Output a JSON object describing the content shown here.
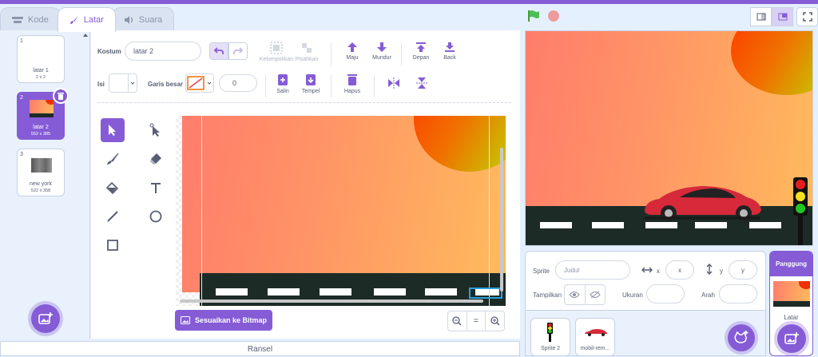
{
  "tabs": {
    "code": "Kode",
    "backdrops": "Latar",
    "sounds": "Suara"
  },
  "costumes": [
    {
      "num": "1",
      "name": "latar 1",
      "size": "2 x 2"
    },
    {
      "num": "2",
      "name": "latar 2",
      "size": "552 x 385"
    },
    {
      "num": "3",
      "name": "new york",
      "size": "522 x 358"
    }
  ],
  "editor": {
    "costume_label": "Kostum",
    "costume_name": "latar 2",
    "group": "Kelompokkan",
    "ungroup": "Pisahkan",
    "forward": "Maju",
    "backward": "Mundur",
    "front": "Depan",
    "back": "Back",
    "fill_label": "Isi",
    "outline_label": "Garis besar",
    "outline_width": "0",
    "copy": "Salin",
    "paste": "Tempel",
    "delete": "Hapus",
    "convert_bitmap": "Sesuaikan ke Bitmap",
    "zoom_reset": "="
  },
  "backpack": "Ransel",
  "sprite_info": {
    "sprite_label": "Sprite",
    "sprite_placeholder": "Judul",
    "x_label": "x",
    "x_placeholder": "x",
    "y_label": "y",
    "y_placeholder": "y",
    "show_label": "Tampilkan",
    "size_label": "Ukuran",
    "direction_label": "Arah"
  },
  "sprites": [
    {
      "name": "Sprite 2"
    },
    {
      "name": "mobil-rem..."
    }
  ],
  "stage_target": {
    "header": "Panggung",
    "label": "Latar"
  },
  "colors": {
    "accent": "#855cd6",
    "road": "#1d2b27"
  }
}
